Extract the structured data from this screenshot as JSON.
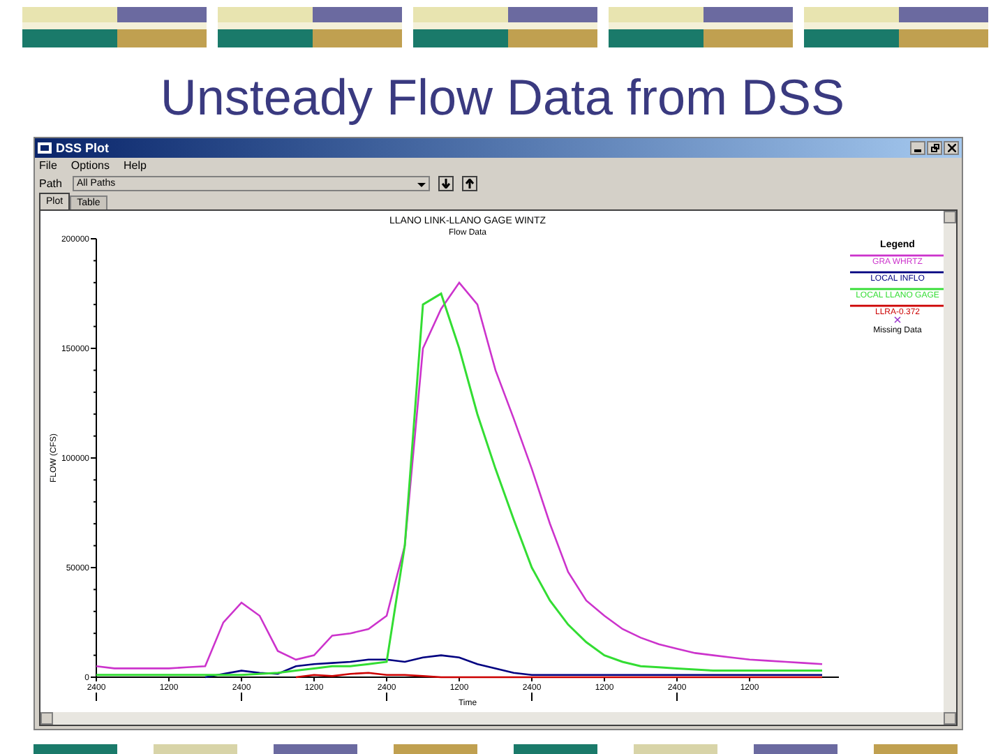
{
  "slide": {
    "title": "Unsteady Flow Data from DSS"
  },
  "window": {
    "title": "DSS Plot"
  },
  "menu": [
    "File",
    "Options",
    "Help"
  ],
  "path": {
    "label": "Path",
    "value": "All Paths"
  },
  "tabs": [
    {
      "label": "Plot",
      "selected": true
    },
    {
      "label": "Table",
      "selected": false
    }
  ],
  "plot": {
    "subtitle": "Flow Data",
    "legend_title": "Legend",
    "missing_label": "Missing Data",
    "chart_data": {
      "type": "line",
      "title": "LLANO LINK-LLANO GAGE WINTZ",
      "xlabel": "Time",
      "ylabel": "FLOW (CFS)",
      "categories": [
        "2400",
        null,
        null,
        null,
        "1200",
        null,
        null,
        null,
        "2400",
        null,
        null,
        null,
        "1200",
        null,
        null,
        null,
        "2400",
        null,
        null,
        null,
        "1200",
        null,
        null,
        null,
        "2400",
        null,
        null,
        null,
        "1200",
        null,
        null,
        null,
        "2400",
        null,
        null,
        null,
        "1200",
        null,
        null,
        null,
        null
      ],
      "series": [
        {
          "name": "GRA WHRTZ",
          "color": "#cc33cc",
          "values": [
            5000,
            4000,
            4000,
            4000,
            4000,
            4500,
            5000,
            25000,
            34000,
            28000,
            12000,
            8000,
            10000,
            19000,
            20000,
            22000,
            28000,
            60000,
            150000,
            168000,
            180000,
            170000,
            140000,
            118000,
            95000,
            70000,
            48000,
            35000,
            28000,
            22000,
            18000,
            15000,
            13000,
            11000,
            10000,
            9000,
            8000,
            7500,
            7000,
            6500,
            6000
          ]
        },
        {
          "name": "LOCAL INFLO",
          "color": "#000080",
          "values": [
            null,
            null,
            null,
            null,
            null,
            null,
            0,
            1500,
            3000,
            2000,
            1500,
            5000,
            6000,
            6500,
            7000,
            8000,
            8000,
            7000,
            9000,
            10000,
            9000,
            6000,
            4000,
            2000,
            1000,
            1000,
            1000,
            1000,
            1000,
            1000,
            1000,
            1000,
            1000,
            1000,
            1000,
            1000,
            1000,
            1000,
            1000,
            1000,
            1000
          ]
        },
        {
          "name": "LOCAL LLANO GAGE",
          "color": "#33dd33",
          "values": [
            1000,
            1000,
            1000,
            1000,
            1000,
            1000,
            1000,
            1000,
            1000,
            1500,
            2000,
            3000,
            4000,
            5000,
            5000,
            6000,
            7000,
            60000,
            170000,
            175000,
            150000,
            120000,
            95000,
            72000,
            50000,
            35000,
            24000,
            16000,
            10000,
            7000,
            5000,
            4500,
            4000,
            3500,
            3000,
            3000,
            3000,
            3000,
            3000,
            3000,
            3000
          ]
        },
        {
          "name": "LLRA-0.372",
          "color": "#cc0000",
          "values": [
            null,
            null,
            null,
            null,
            null,
            null,
            null,
            null,
            null,
            null,
            null,
            0,
            1000,
            500,
            1500,
            2000,
            1000,
            1000,
            500,
            0,
            0,
            0,
            0,
            0,
            0,
            0,
            0,
            0,
            0,
            0,
            0,
            0,
            0,
            0,
            0,
            0,
            0,
            0,
            0,
            0,
            0
          ]
        }
      ],
      "ylim": [
        0,
        200000
      ],
      "yticks": [
        {
          "value": 0,
          "label": "0"
        },
        {
          "value": 50000,
          "label": "50000"
        },
        {
          "value": 100000,
          "label": "100000"
        },
        {
          "value": 150000,
          "label": "150000"
        },
        {
          "value": 200000,
          "label": "200000"
        }
      ]
    }
  }
}
